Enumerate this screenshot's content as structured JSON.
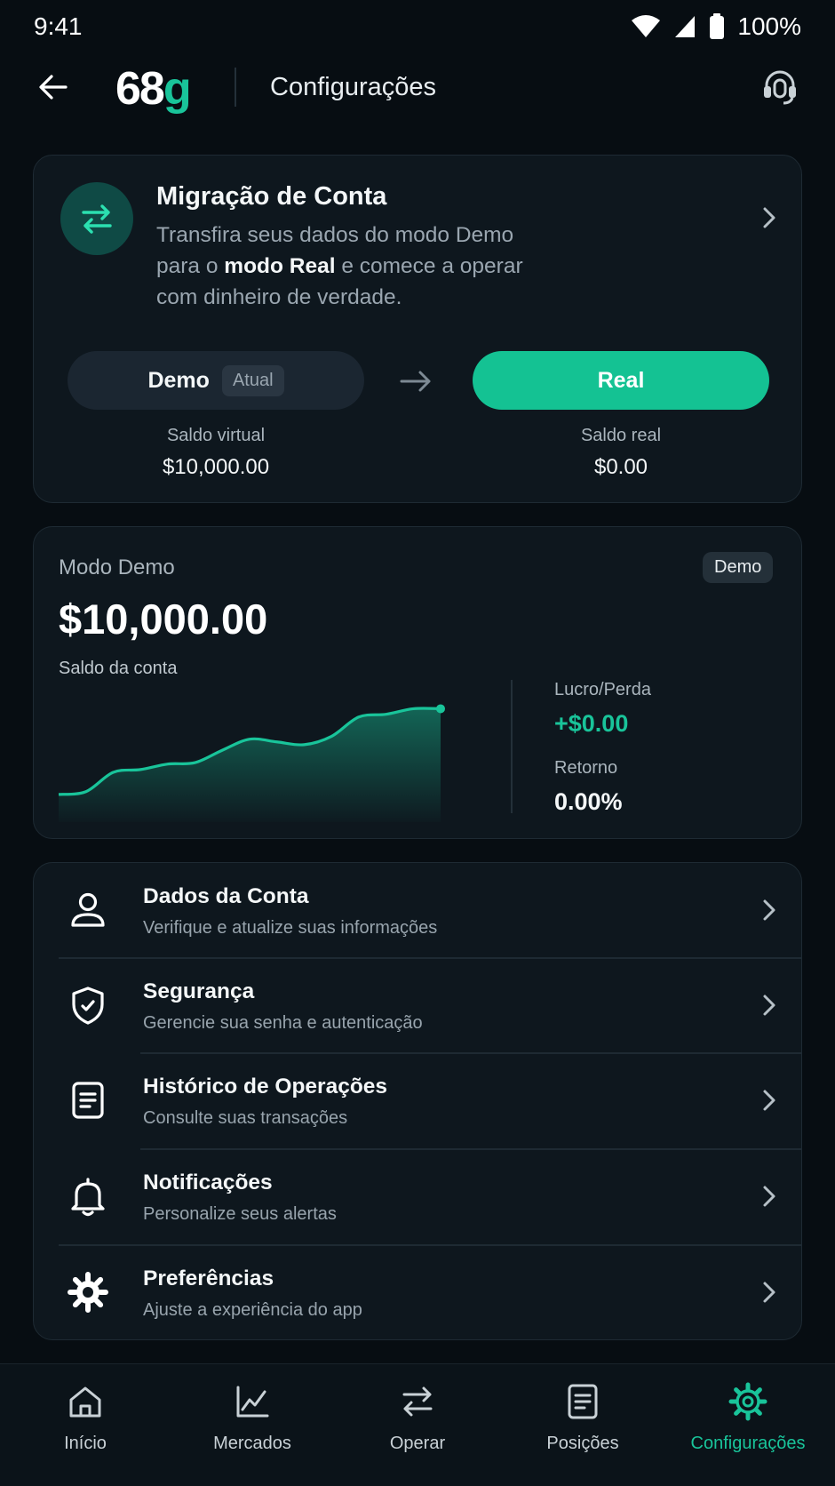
{
  "status_bar": {
    "time": "9:41",
    "battery": "100%"
  },
  "header": {
    "logo_main": "68",
    "logo_accent": "g",
    "title": "Configurações"
  },
  "migration": {
    "title": "Migração de Conta",
    "desc_part1": "Transfira seus dados do modo Demo para o ",
    "desc_bold": "modo Real",
    "desc_part2": " e comece a operar com dinheiro de verdade.",
    "demo_label": "Demo",
    "demo_badge": "Atual",
    "real_label": "Real",
    "virtual_balance_label": "Saldo virtual",
    "virtual_balance_value": "$10,000.00",
    "real_balance_label": "Saldo real",
    "real_balance_value": "$0.00"
  },
  "demo_account": {
    "mode_label": "Modo Demo",
    "tag": "Demo",
    "balance": "$10,000.00",
    "balance_label": "Saldo da conta",
    "pl_label": "Lucro/Perda",
    "pl_value": "+$0.00",
    "return_label": "Retorno",
    "return_value": "0.00%"
  },
  "chart_data": {
    "type": "area",
    "title": "",
    "xlabel": "",
    "ylabel": "",
    "values": [
      10,
      11,
      18,
      19,
      21,
      21.5,
      26,
      30,
      29,
      28,
      31,
      38,
      39,
      41,
      41
    ],
    "ylim": [
      0,
      45
    ],
    "grid": false,
    "color": "#19c49a"
  },
  "menu": {
    "items": [
      {
        "title": "Dados da Conta",
        "subtitle": "Verifique e atualize suas informações",
        "icon": "user-icon"
      },
      {
        "title": "Segurança",
        "subtitle": "Gerencie sua senha e autenticação",
        "icon": "shield-icon"
      },
      {
        "title": "Histórico de Operações",
        "subtitle": "Consulte suas transações",
        "icon": "document-icon"
      },
      {
        "title": "Notificações",
        "subtitle": "Personalize seus alertas",
        "icon": "bell-icon"
      },
      {
        "title": "Preferências",
        "subtitle": "Ajuste a experiência do app",
        "icon": "gear-icon"
      }
    ]
  },
  "bottom_nav": {
    "items": [
      {
        "label": "Início",
        "icon": "home-icon"
      },
      {
        "label": "Mercados",
        "icon": "chart-icon"
      },
      {
        "label": "Operar",
        "icon": "swap-icon"
      },
      {
        "label": "Posições",
        "icon": "document-icon"
      },
      {
        "label": "Configurações",
        "icon": "gear-icon"
      }
    ],
    "active": "Configurações"
  },
  "colors": {
    "background": "#070d12",
    "card": "#0e171e",
    "accent": "#19c49a",
    "text_secondary": "#9aa6b0"
  }
}
